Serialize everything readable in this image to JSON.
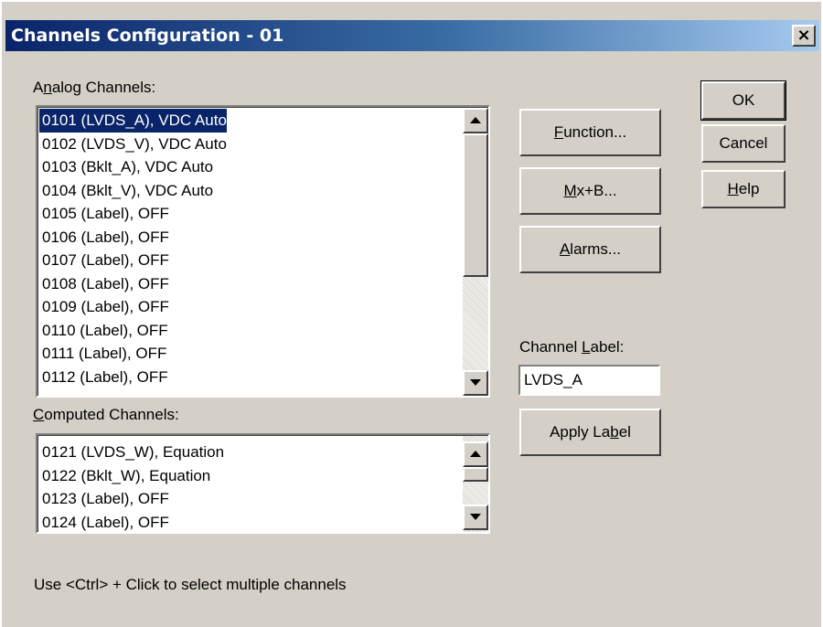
{
  "window": {
    "title": "Channels Configuration - 01",
    "close_glyph": "×"
  },
  "analog": {
    "label": "Analog Channels:",
    "items": [
      "0101 (LVDS_A), VDC Auto",
      "0102 (LVDS_V), VDC Auto",
      "0103 (Bklt_A), VDC Auto",
      "0104 (Bklt_V), VDC Auto",
      "0105 (Label),  OFF",
      "0106 (Label),  OFF",
      "0107 (Label),  OFF",
      "0108 (Label),  OFF",
      "0109 (Label),  OFF",
      "0110 (Label),  OFF",
      "0111 (Label),  OFF",
      "0112 (Label),  OFF"
    ],
    "selected": 0
  },
  "computed": {
    "label": "Computed Channels:",
    "items": [
      "0121 (LVDS_W), Equation",
      "0122 (Bklt_W), Equation",
      "0123 (Label),  OFF",
      "0124 (Label),  OFF"
    ]
  },
  "buttons": {
    "function": "Function...",
    "mxb": "Mx+B...",
    "alarms": "Alarms...",
    "ok": "OK",
    "cancel": "Cancel",
    "help": "Help",
    "apply_label": "Apply Label"
  },
  "channel_label": {
    "label": "Channel Label:",
    "value": "LVDS_A"
  },
  "hint": "Use <Ctrl> + Click to select multiple channels",
  "colors": {
    "selection": "#0a246a",
    "dialog_face": "#d4d0c8"
  }
}
